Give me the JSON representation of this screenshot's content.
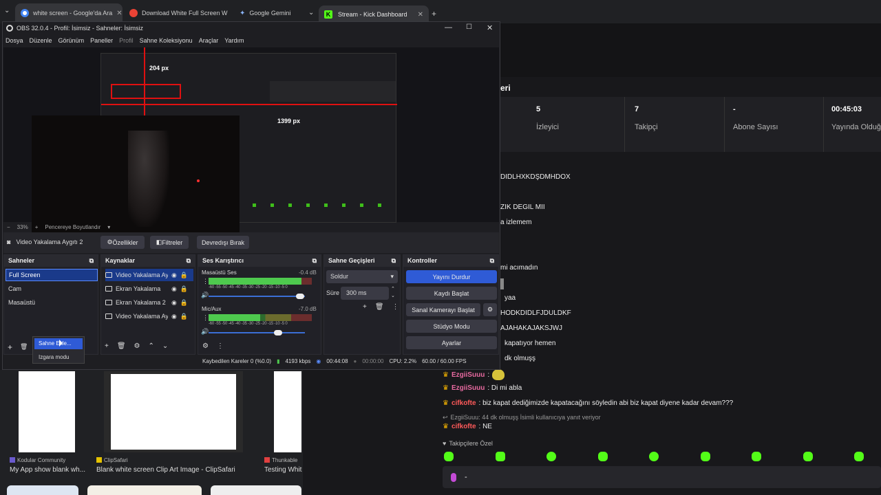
{
  "browser_tabs": [
    {
      "label": "white screen - Google'da Ara",
      "color": "#4285f4"
    },
    {
      "label": "Download White Full Screen W",
      "color": "#ea4335"
    },
    {
      "label": "Google Gemini",
      "color": "#8ab4f8"
    }
  ],
  "kick_tab": {
    "label": "Stream - Kick Dashboard",
    "new_tab": "+"
  },
  "kick": {
    "section_title": "eri",
    "stats": [
      {
        "value": "5",
        "label": "İzleyici"
      },
      {
        "value": "7",
        "label": "Takipçi"
      },
      {
        "value": "-",
        "label": "Abone Sayısı"
      },
      {
        "value": "00:45:03",
        "label": "Yayında Olduğ"
      }
    ],
    "chat_fragments": [
      "DIDLHXKDŞDMHDOX",
      "ZIK DEGIL MII",
      "a izlemem",
      "mi acımadın",
      "yaa",
      "HODKDIDLFJDULDKF",
      "AJAHAKAJAKSJWJ",
      "kapatıyor hemen",
      "dk olmuşş"
    ],
    "messages": [
      {
        "user": "EzgiiSuuu",
        "text": "",
        "user_color": "#e86aa0"
      },
      {
        "user": "EzgiiSuuu",
        "text": ": Di mi abla",
        "user_color": "#e86aa0"
      },
      {
        "user": "cifkofte",
        "text": ": biz kapat dediğimizde kapatacağını söyledin abi biz kapat diyene kadar devam???",
        "user_color": "#ff5a5a"
      },
      {
        "user": "cifkofte",
        "text": ": NE",
        "user_color": "#ff5a5a"
      }
    ],
    "reply_note": "EzgiiSuuu: 44 dk olmuşş İsimli kullanıcıya yanıt veriyor",
    "followers_only": "Takipçilere Özel",
    "input_value": "-"
  },
  "bottom_results": [
    {
      "source": "Kodular Community",
      "title": "My App show blank wh..."
    },
    {
      "source": "ClipSafari",
      "title": "Blank white screen Clip Art Image - ClipSafari"
    },
    {
      "source": "Thunkable",
      "title": "Testing Whit"
    }
  ],
  "obs": {
    "title": "OBS 32.0.4 - Profil: İsimsiz - Sahneler: İsimsiz",
    "menu": [
      "Dosya",
      "Düzenle",
      "Görünüm",
      "Paneller",
      "Profil",
      "Sahne Koleksiyonu",
      "Araçlar",
      "Yardım"
    ],
    "preview_labels": {
      "px1": "204 px",
      "px2": "1399 px"
    },
    "zoom": "33%",
    "zoom_mode": "Pencereye Boyutlandır",
    "selected_source": "Video Yakalama Aygıtı 2",
    "source_buttons": [
      "Özellikler",
      "Filtreler",
      "Devredışı Bırak"
    ],
    "scenes": {
      "title": "Sahneler",
      "items": [
        "Full Screen",
        "Cam",
        "Masaüstü"
      ],
      "context_menu": [
        "Sahne Ekle...",
        "Izgara modu"
      ]
    },
    "sources": {
      "title": "Kaynaklar",
      "items": [
        "Video Yakalama Aygıtı",
        "Ekran Yakalama",
        "Ekran Yakalama 2",
        "Video Yakalama Aygıtı"
      ]
    },
    "mixer": {
      "title": "Ses Karıştırıcı",
      "channels": [
        {
          "name": "Masaüstü Ses",
          "db": "-0.4 dB",
          "level": 0.9,
          "volume": 0.95
        },
        {
          "name": "Mic/Aux",
          "db": "-7.0 dB",
          "level": 0.5,
          "volume": 0.72
        }
      ],
      "scale": "-60 -55 -50 -45 -40 -35 -30 -25 -20 -15 -10 -5 0"
    },
    "transitions": {
      "title": "Sahne Geçişleri",
      "type": "Soldur",
      "duration_label": "Süre",
      "duration": "300 ms"
    },
    "controls": {
      "title": "Kontroller",
      "buttons": [
        "Yayını Durdur",
        "Kaydı Başlat",
        "Sanal Kamerayı Başlat",
        "Stüdyo Modu",
        "Ayarlar"
      ]
    },
    "status": {
      "dropped": "Kaybedilen Kareler 0 (%0.0)",
      "bitrate": "4193 kbps",
      "stream_time": "00:44:08",
      "rec_time": "00:00:00",
      "cpu": "CPU: 2.2%",
      "fps": "60.00 / 60.00 FPS"
    }
  }
}
